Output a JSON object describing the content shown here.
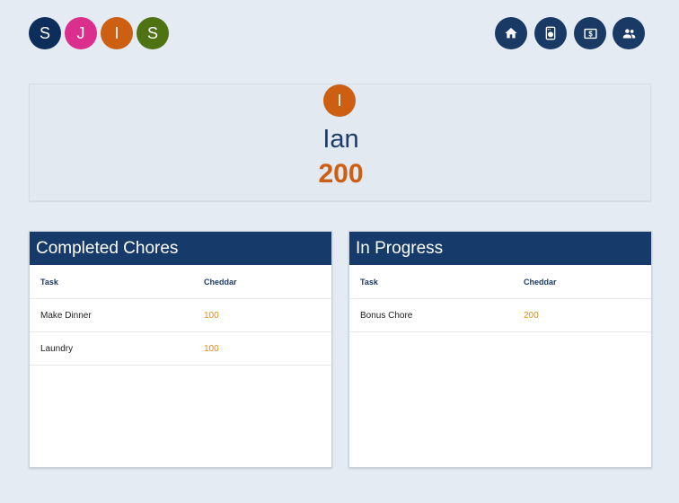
{
  "colors": {
    "navy": "#1a3a66",
    "header": "#163a69",
    "accent_orange": "#cc5f12",
    "value_orange": "#e88d12",
    "background": "#e4ebf3"
  },
  "family": [
    {
      "initial": "S",
      "color": "#0d2d5a"
    },
    {
      "initial": "J",
      "color": "#dc2e8c"
    },
    {
      "initial": "I",
      "color": "#cc5f12"
    },
    {
      "initial": "S",
      "color": "#4f7212"
    }
  ],
  "nav": [
    {
      "icon": "home-icon"
    },
    {
      "icon": "washing-machine-icon"
    },
    {
      "icon": "money-icon"
    },
    {
      "icon": "people-icon"
    }
  ],
  "profile": {
    "initial": "I",
    "name": "Ian",
    "points": "200"
  },
  "completed": {
    "title": "Completed Chores",
    "columns": [
      "Task",
      "Cheddar"
    ],
    "rows": [
      {
        "task": "Make Dinner",
        "cheddar": "100"
      },
      {
        "task": "Laundry",
        "cheddar": "100"
      }
    ]
  },
  "in_progress": {
    "title": "In Progress",
    "columns": [
      "Task",
      "Cheddar"
    ],
    "rows": [
      {
        "task": "Bonus Chore",
        "cheddar": "200"
      }
    ]
  }
}
